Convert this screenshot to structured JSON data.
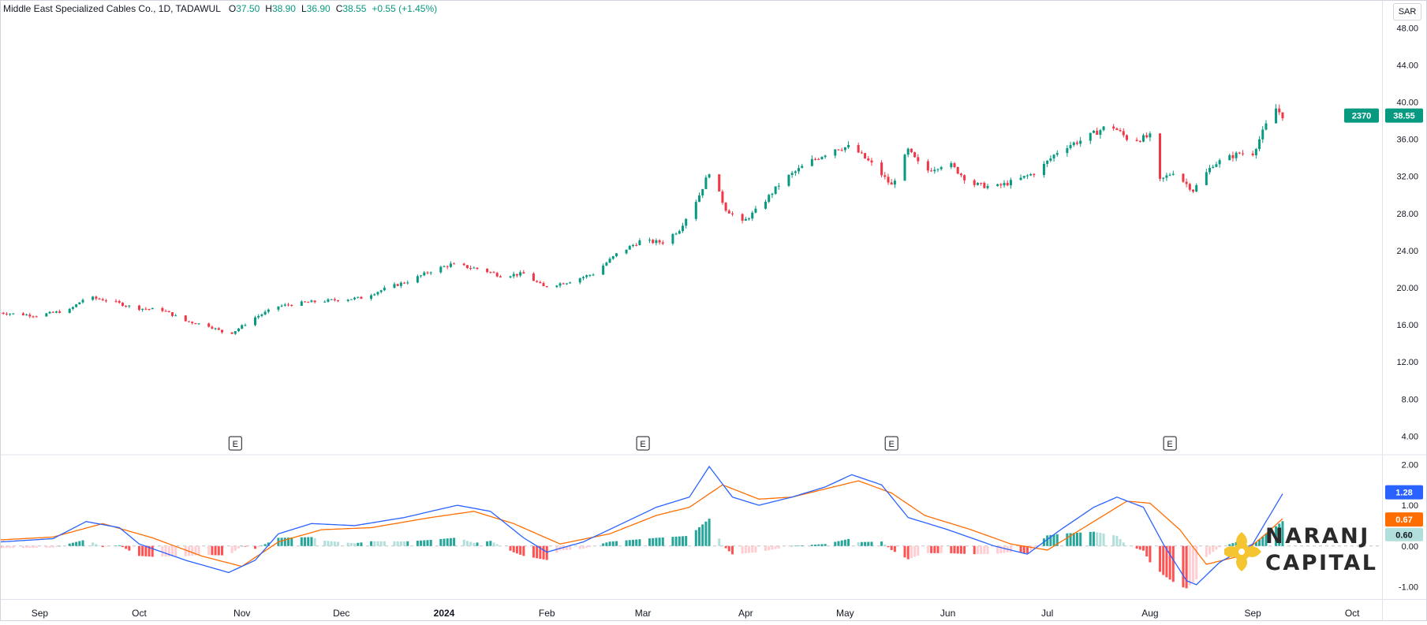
{
  "header": {
    "symbol": "Middle East Specialized Cables Co., 1D, TADAWUL",
    "o_label": "O",
    "o_value": "37.50",
    "h_label": "H",
    "h_value": "38.90",
    "l_label": "L",
    "l_value": "36.90",
    "c_label": "C",
    "c_value": "38.55",
    "change": "+0.55 (+1.45%)"
  },
  "currency": "SAR",
  "colors": {
    "up": "#089981",
    "down": "#f23645",
    "macd": "#2962ff",
    "signal": "#ff6d00",
    "hist_up_strong": "#26a69a",
    "hist_up_weak": "#b2dfdb",
    "hist_down_strong": "#ff5252",
    "hist_down_weak": "#ffcdd2"
  },
  "chart_data": [
    {
      "type": "candlestick",
      "price_axis": {
        "ticks": [
          "4.00",
          "8.00",
          "12.00",
          "16.00",
          "20.00",
          "24.00",
          "28.00",
          "32.00",
          "36.00",
          "40.00",
          "44.00",
          "48.00"
        ],
        "ylim": [
          2,
          51
        ]
      },
      "x_ticks": [
        "Sep",
        "Oct",
        "Nov",
        "Dec",
        "2024",
        "Feb",
        "Mar",
        "Apr",
        "May",
        "Jun",
        "Jul",
        "Aug",
        "Sep",
        "Oct"
      ],
      "last_price_label": "38.55",
      "countdown_label": "2370",
      "earnings_markers": [
        "E",
        "E",
        "E",
        "E"
      ],
      "earnings_dates": [
        "2023-10-30",
        "2024-03-01",
        "2024-05-15",
        "2024-08-07"
      ],
      "price_path": [
        [
          "2023-08-20",
          17.3
        ],
        [
          "2023-08-31",
          17.0
        ],
        [
          "2023-09-10",
          17.6
        ],
        [
          "2023-09-15",
          19.0
        ],
        [
          "2023-09-22",
          18.6
        ],
        [
          "2023-09-30",
          17.8
        ],
        [
          "2023-10-08",
          17.6
        ],
        [
          "2023-10-15",
          16.4
        ],
        [
          "2023-10-22",
          15.9
        ],
        [
          "2023-10-28",
          14.9
        ],
        [
          "2023-11-05",
          16.8
        ],
        [
          "2023-11-12",
          18.0
        ],
        [
          "2023-11-20",
          18.4
        ],
        [
          "2023-11-30",
          18.7
        ],
        [
          "2023-12-07",
          18.9
        ],
        [
          "2023-12-15",
          20.0
        ],
        [
          "2023-12-22",
          20.8
        ],
        [
          "2023-12-28",
          21.8
        ],
        [
          "2024-01-03",
          22.5
        ],
        [
          "2024-01-12",
          22.0
        ],
        [
          "2024-01-18",
          21.3
        ],
        [
          "2024-01-25",
          21.5
        ],
        [
          "2024-01-31",
          20.1
        ],
        [
          "2024-02-07",
          20.6
        ],
        [
          "2024-02-15",
          21.5
        ],
        [
          "2024-02-22",
          23.6
        ],
        [
          "2024-02-29",
          25.0
        ],
        [
          "2024-03-07",
          24.9
        ],
        [
          "2024-03-12",
          26.3
        ],
        [
          "2024-03-18",
          30.0
        ],
        [
          "2024-03-21",
          32.5
        ],
        [
          "2024-03-26",
          28.5
        ],
        [
          "2024-03-31",
          27.0
        ],
        [
          "2024-04-05",
          28.6
        ],
        [
          "2024-04-12",
          31.5
        ],
        [
          "2024-04-20",
          33.5
        ],
        [
          "2024-04-28",
          35.0
        ],
        [
          "2024-05-03",
          35.2
        ],
        [
          "2024-05-10",
          33.0
        ],
        [
          "2024-05-15",
          31.0
        ],
        [
          "2024-05-20",
          34.8
        ],
        [
          "2024-05-25",
          32.5
        ],
        [
          "2024-06-01",
          33.5
        ],
        [
          "2024-06-08",
          31.2
        ],
        [
          "2024-06-15",
          30.8
        ],
        [
          "2024-06-22",
          31.6
        ],
        [
          "2024-06-28",
          32.5
        ],
        [
          "2024-07-05",
          35.0
        ],
        [
          "2024-07-12",
          36.0
        ],
        [
          "2024-07-20",
          37.6
        ],
        [
          "2024-07-26",
          35.8
        ],
        [
          "2024-08-01",
          36.3
        ],
        [
          "2024-08-04",
          31.5
        ],
        [
          "2024-08-08",
          32.5
        ],
        [
          "2024-08-14",
          30.5
        ],
        [
          "2024-08-20",
          33.3
        ],
        [
          "2024-08-28",
          34.5
        ],
        [
          "2024-09-01",
          34.5
        ],
        [
          "2024-09-05",
          37.5
        ],
        [
          "2024-09-08",
          39.3
        ],
        [
          "2024-09-10",
          38.55
        ]
      ]
    },
    {
      "type": "macd",
      "y_ticks": [
        "-1.00",
        "0.00",
        "1.00",
        "2.00"
      ],
      "ylim": [
        -1.3,
        2.2
      ],
      "macd_last_label": "1.28",
      "signal_last_label": "0.67",
      "histogram_last_label": "0.60",
      "macd_path": [
        [
          "2023-08-20",
          0.1
        ],
        [
          "2023-09-05",
          0.18
        ],
        [
          "2023-09-15",
          0.6
        ],
        [
          "2023-09-25",
          0.45
        ],
        [
          "2023-10-01",
          0.05
        ],
        [
          "2023-10-15",
          -0.35
        ],
        [
          "2023-10-28",
          -0.65
        ],
        [
          "2023-11-05",
          -0.35
        ],
        [
          "2023-11-12",
          0.3
        ],
        [
          "2023-11-22",
          0.55
        ],
        [
          "2023-12-05",
          0.5
        ],
        [
          "2023-12-20",
          0.7
        ],
        [
          "2024-01-05",
          1.0
        ],
        [
          "2024-01-15",
          0.85
        ],
        [
          "2024-01-25",
          0.2
        ],
        [
          "2024-02-01",
          -0.15
        ],
        [
          "2024-02-12",
          0.1
        ],
        [
          "2024-02-25",
          0.6
        ],
        [
          "2024-03-05",
          0.95
        ],
        [
          "2024-03-15",
          1.2
        ],
        [
          "2024-03-21",
          1.95
        ],
        [
          "2024-03-28",
          1.2
        ],
        [
          "2024-04-05",
          1.0
        ],
        [
          "2024-04-15",
          1.2
        ],
        [
          "2024-04-25",
          1.45
        ],
        [
          "2024-05-03",
          1.75
        ],
        [
          "2024-05-12",
          1.5
        ],
        [
          "2024-05-20",
          0.7
        ],
        [
          "2024-06-01",
          0.4
        ],
        [
          "2024-06-15",
          0.0
        ],
        [
          "2024-06-25",
          -0.2
        ],
        [
          "2024-07-05",
          0.4
        ],
        [
          "2024-07-15",
          0.95
        ],
        [
          "2024-07-22",
          1.2
        ],
        [
          "2024-07-30",
          0.95
        ],
        [
          "2024-08-05",
          0.05
        ],
        [
          "2024-08-12",
          -0.85
        ],
        [
          "2024-08-15",
          -0.95
        ],
        [
          "2024-08-22",
          -0.4
        ],
        [
          "2024-09-01",
          0.05
        ],
        [
          "2024-09-05",
          0.6
        ],
        [
          "2024-09-10",
          1.28
        ]
      ],
      "signal_path": [
        [
          "2023-08-20",
          0.15
        ],
        [
          "2023-09-05",
          0.22
        ],
        [
          "2023-09-20",
          0.55
        ],
        [
          "2023-10-05",
          0.2
        ],
        [
          "2023-10-20",
          -0.25
        ],
        [
          "2023-11-01",
          -0.5
        ],
        [
          "2023-11-12",
          0.1
        ],
        [
          "2023-11-25",
          0.4
        ],
        [
          "2023-12-10",
          0.45
        ],
        [
          "2023-12-28",
          0.7
        ],
        [
          "2024-01-10",
          0.85
        ],
        [
          "2024-01-22",
          0.55
        ],
        [
          "2024-02-05",
          0.05
        ],
        [
          "2024-02-20",
          0.3
        ],
        [
          "2024-03-05",
          0.75
        ],
        [
          "2024-03-15",
          0.95
        ],
        [
          "2024-03-25",
          1.5
        ],
        [
          "2024-04-05",
          1.15
        ],
        [
          "2024-04-15",
          1.2
        ],
        [
          "2024-04-25",
          1.4
        ],
        [
          "2024-05-05",
          1.6
        ],
        [
          "2024-05-15",
          1.3
        ],
        [
          "2024-05-25",
          0.75
        ],
        [
          "2024-06-08",
          0.4
        ],
        [
          "2024-06-20",
          0.05
        ],
        [
          "2024-07-01",
          -0.1
        ],
        [
          "2024-07-12",
          0.45
        ],
        [
          "2024-07-25",
          1.1
        ],
        [
          "2024-08-01",
          1.05
        ],
        [
          "2024-08-10",
          0.4
        ],
        [
          "2024-08-18",
          -0.45
        ],
        [
          "2024-08-28",
          -0.25
        ],
        [
          "2024-09-05",
          0.3
        ],
        [
          "2024-09-10",
          0.67
        ]
      ]
    }
  ]
}
